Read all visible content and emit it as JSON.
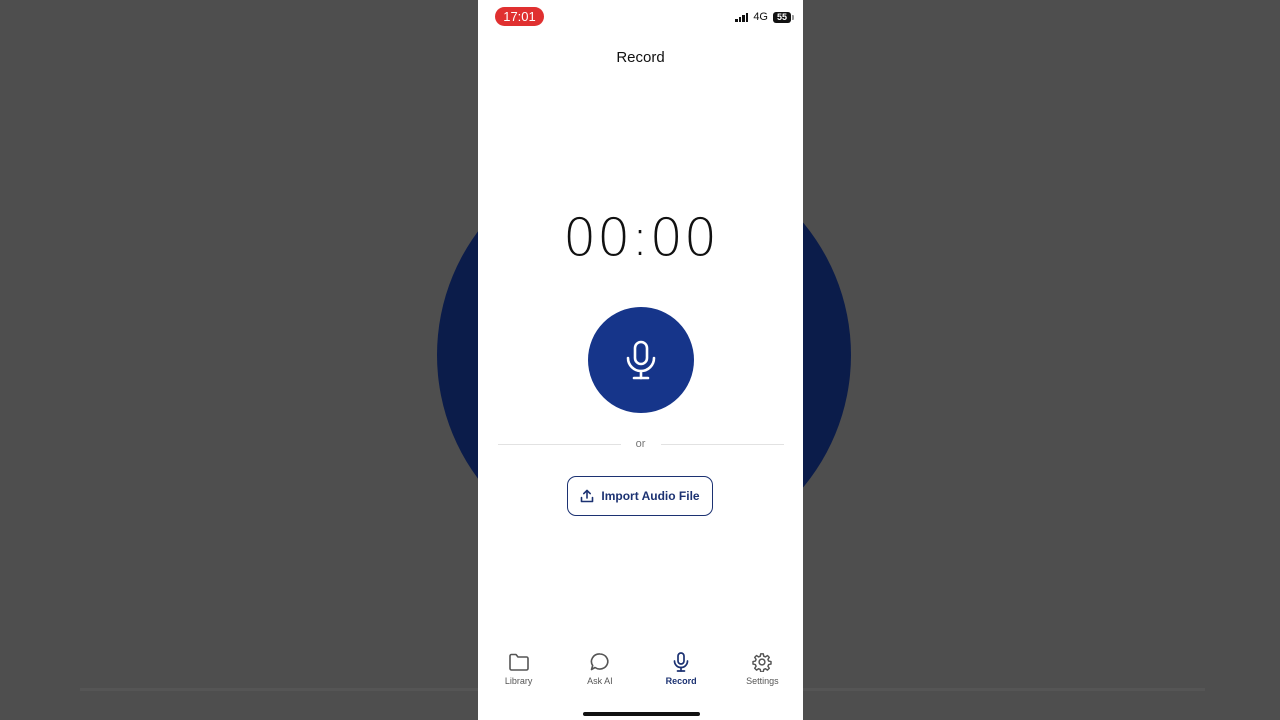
{
  "status_bar": {
    "time": "17:01",
    "network": "4G",
    "battery": "55",
    "icons": [
      "signal-icon",
      "battery-icon"
    ]
  },
  "header": {
    "title": "Record"
  },
  "recorder": {
    "timer": "00:00",
    "mic_icon": "microphone-icon",
    "accent_color": "#16358a"
  },
  "divider": {
    "text": "or"
  },
  "import": {
    "label": "Import Audio File",
    "icon": "upload-icon"
  },
  "tabs": [
    {
      "label": "Library",
      "icon": "folder-icon",
      "active": false
    },
    {
      "label": "Ask AI",
      "icon": "chat-bubble-icon",
      "active": false
    },
    {
      "label": "Record",
      "icon": "microphone-icon",
      "active": true
    },
    {
      "label": "Settings",
      "icon": "gear-icon",
      "active": false
    }
  ]
}
